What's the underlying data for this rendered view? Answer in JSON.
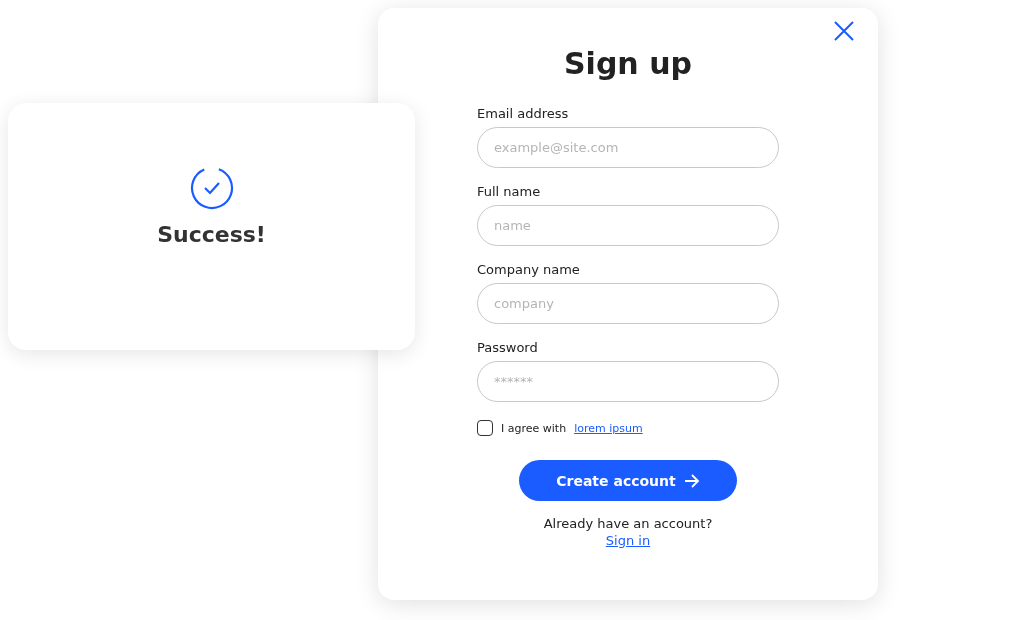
{
  "success_card": {
    "message": "Success!"
  },
  "signup": {
    "title": "Sign up",
    "fields": [
      {
        "label": "Email address",
        "placeholder": "example@site.com"
      },
      {
        "label": "Full name",
        "placeholder": "name"
      },
      {
        "label": "Company name",
        "placeholder": "company"
      },
      {
        "label": "Password",
        "placeholder": "******"
      }
    ],
    "agreement": {
      "checked": false,
      "text": "I agree with",
      "link": "lorem ipsum"
    },
    "submit_button": "Create account",
    "footer": {
      "text": "Already have an account?",
      "link": "Sign in"
    }
  }
}
